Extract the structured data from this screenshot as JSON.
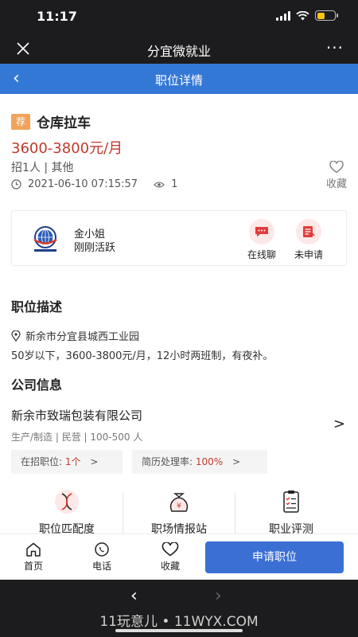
{
  "status_bar": {
    "time": "11:17"
  },
  "app_bar": {
    "title": "分宜微就业",
    "more_label": "···"
  },
  "nav": {
    "back_label": "‹",
    "title": "职位详情"
  },
  "job": {
    "tag": "荐",
    "title": "仓库拉车",
    "salary": "3600-3800元/月",
    "recruit_info": "招1人 | 其他",
    "posted_at": "2021-06-10 07:15:57",
    "views": "1",
    "favorite_label": "收藏"
  },
  "contact": {
    "name": "金小姐",
    "status": "刚刚活跃",
    "chat_label": "在线聊",
    "apply_status_label": "未申请"
  },
  "description": {
    "title": "职位描述",
    "location": "新余市分宜县城西工业园",
    "text": "50岁以下，3600-3800元/月，12小时两班制，有夜补。"
  },
  "company": {
    "title": "公司信息",
    "name": "新余市致瑞包装有限公司",
    "meta": "生产/制造 | 民营 | 100-500 人",
    "open_positions_label": "在招职位:",
    "open_positions_value": "1个",
    "resume_rate_label": "简历处理率:",
    "resume_rate_value": "100%"
  },
  "tools": [
    {
      "label": "职位匹配度",
      "icon": "dna-icon"
    },
    {
      "label": "职场情报站",
      "icon": "money-bag-icon"
    },
    {
      "label": "职业评测",
      "icon": "clipboard-icon"
    }
  ],
  "bottom_bar": {
    "home_label": "首页",
    "phone_label": "电话",
    "favorite_label": "收藏",
    "apply_label": "申请职位"
  },
  "browser": {
    "back_label": "‹",
    "forward_label": "›",
    "watermark": "11玩意儿 • 11WYX.COM"
  },
  "colors": {
    "primary": "#3478d6",
    "apply_button": "#3b6fd4",
    "salary": "#c0392b",
    "tag": "#f0a35a",
    "dark_bar": "#1c1c1e"
  }
}
